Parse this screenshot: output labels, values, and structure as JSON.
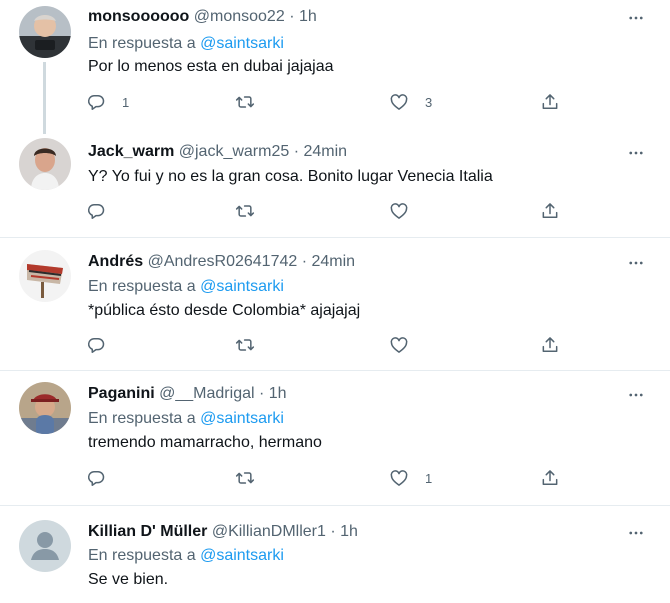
{
  "replying_label": "En respuesta a",
  "colors": {
    "accent": "#1d9bf0",
    "muted": "#536471",
    "text": "#0f1419",
    "divider": "#e6ecf0"
  },
  "icons": {
    "reply": "reply-icon",
    "retweet": "retweet-icon",
    "like": "heart-icon",
    "share": "share-icon",
    "more": "more-icon"
  },
  "tweets": [
    {
      "name": "monsoooooo",
      "handle": "@monsoo22",
      "time": "1h",
      "reply_to": "@saintsarki",
      "text": "Por lo menos esta en dubai jajajaa",
      "replies": "1",
      "retweets": "",
      "likes": "3"
    },
    {
      "name": "Jack_warm",
      "handle": "@jack_warm25",
      "time": "24min",
      "text": "Y? Yo fui y no es la gran cosa. Bonito lugar Venecia Italia",
      "replies": "",
      "retweets": "",
      "likes": ""
    },
    {
      "name": "Andrés",
      "handle": "@AndresR02641742",
      "time": "24min",
      "reply_to": "@saintsarki",
      "text": "*pública ésto desde Colombia* ajajajaj",
      "replies": "",
      "retweets": "",
      "likes": ""
    },
    {
      "name": "Paganini",
      "handle": "@__Madrigal",
      "time": "1h",
      "reply_to": "@saintsarki",
      "text": "tremendo mamarracho, hermano",
      "replies": "",
      "retweets": "",
      "likes": "1"
    },
    {
      "name": "Killian D' Müller",
      "handle": "@KillianDMller1",
      "time": "1h",
      "reply_to": "@saintsarki",
      "text": "Se ve bien."
    }
  ]
}
